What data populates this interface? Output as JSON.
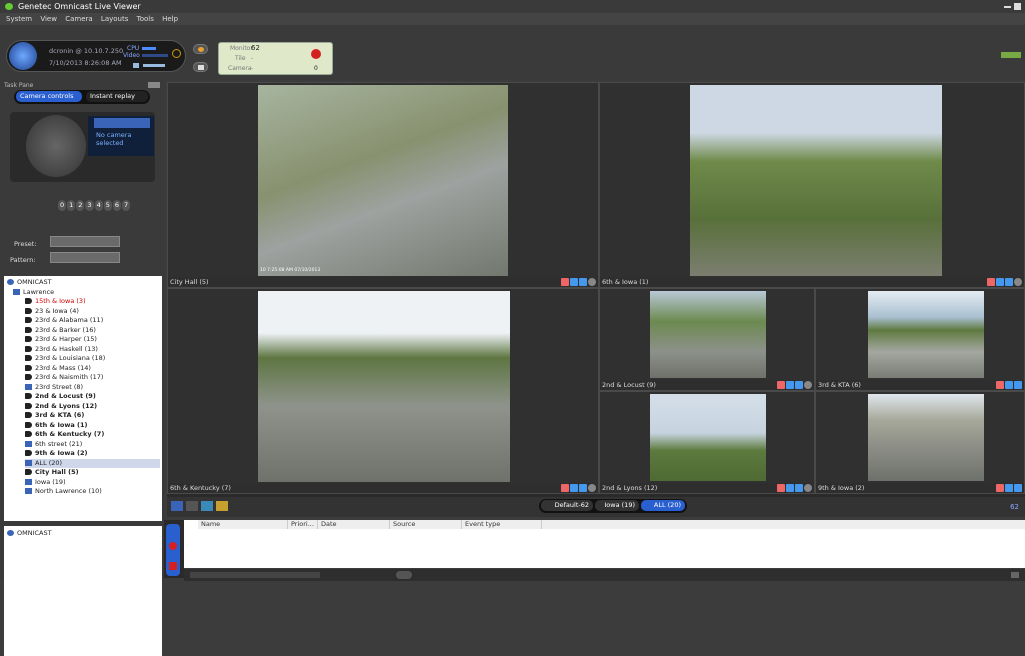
{
  "window": {
    "title": "Genetec Omnicast Live Viewer"
  },
  "menu": [
    "System",
    "View",
    "Camera",
    "Layouts",
    "Tools",
    "Help"
  ],
  "status": {
    "user": "dcronin @ 10.10.7.250",
    "datetime": "7/10/2013 8:26:08 AM",
    "cpu_label": "CPU",
    "video_label": "Video",
    "monitor_label": "Monitor",
    "monitor_value": "62",
    "tile_label": "Tile",
    "tile_value": "-",
    "camera_label": "Camera",
    "camera_value": "-",
    "alarm_count": "0"
  },
  "task_pane": {
    "title": "Task Pane",
    "tabs": [
      "Camera controls",
      "Instant replay"
    ],
    "ptz_message": "No camera selected",
    "preset_numbers": [
      "0",
      "1",
      "2",
      "3",
      "4",
      "5",
      "6",
      "7"
    ],
    "preset_label": "Preset:",
    "pattern_label": "Pattern:"
  },
  "tree": {
    "root": "OMNICAST",
    "group": "Lawrence",
    "items": [
      {
        "label": "15th & Iowa (3)",
        "type": "cam",
        "style": "red"
      },
      {
        "label": "23 & Iowa (4)",
        "type": "cam",
        "style": ""
      },
      {
        "label": "23rd & Alabama (11)",
        "type": "cam",
        "style": ""
      },
      {
        "label": "23rd & Barker (16)",
        "type": "cam",
        "style": ""
      },
      {
        "label": "23rd & Harper (15)",
        "type": "cam",
        "style": ""
      },
      {
        "label": "23rd & Haskell (13)",
        "type": "cam",
        "style": ""
      },
      {
        "label": "23rd & Louisiana (18)",
        "type": "cam",
        "style": ""
      },
      {
        "label": "23rd & Mass (14)",
        "type": "cam",
        "style": ""
      },
      {
        "label": "23rd & Naismith (17)",
        "type": "cam",
        "style": ""
      },
      {
        "label": "23rd Street (8)",
        "type": "seq",
        "style": ""
      },
      {
        "label": "2nd & Locust (9)",
        "type": "cam",
        "style": "bold"
      },
      {
        "label": "2nd & Lyons (12)",
        "type": "cam",
        "style": "bold"
      },
      {
        "label": "3rd & KTA (6)",
        "type": "cam",
        "style": "bold"
      },
      {
        "label": "6th & Iowa (1)",
        "type": "cam",
        "style": "bold"
      },
      {
        "label": "6th & Kentucky (7)",
        "type": "cam",
        "style": "bold"
      },
      {
        "label": "6th street (21)",
        "type": "seq",
        "style": ""
      },
      {
        "label": "9th & Iowa (2)",
        "type": "cam",
        "style": "bold"
      },
      {
        "label": "ALL (20)",
        "type": "seq",
        "style": "sel"
      },
      {
        "label": "City Hall (5)",
        "type": "cam",
        "style": "bold"
      },
      {
        "label": "Iowa (19)",
        "type": "seq",
        "style": ""
      },
      {
        "label": "North Lawrence (10)",
        "type": "seq",
        "style": ""
      }
    ],
    "bottom_root": "OMNICAST"
  },
  "tiles": [
    {
      "caption": "City Hall (5)",
      "timestamp": "10 7:25:08 AM 07/10/2013"
    },
    {
      "caption": "6th & Iowa (1)",
      "timestamp": ""
    },
    {
      "caption": "6th & Kentucky (7)",
      "timestamp": ""
    },
    {
      "caption": "2nd & Locust (9)",
      "timestamp": ""
    },
    {
      "caption": "3rd & KTA (6)",
      "timestamp": ""
    },
    {
      "caption": "2nd & Lyons (12)",
      "timestamp": ""
    },
    {
      "caption": "9th & Iowa (2)",
      "timestamp": ""
    }
  ],
  "layout_tabs": [
    "Default-62",
    "Iowa (19)",
    "ALL (20)"
  ],
  "monitor_number": "62",
  "events": {
    "columns": [
      "Name",
      "Priori...",
      "Date",
      "Source",
      "Event type"
    ]
  },
  "colors": {
    "accent": "#3a64b8",
    "selected_tab": "#2a5fd0",
    "alarm": "#d42020"
  }
}
